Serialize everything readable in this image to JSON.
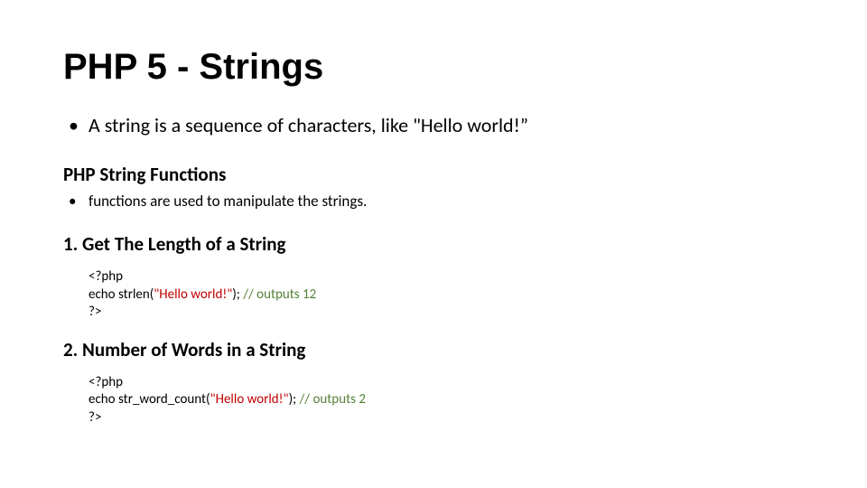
{
  "title": "PHP 5 -  Strings",
  "intro_bullet": "A string is a sequence of characters, like \"Hello world!”",
  "functions_heading": "PHP String Functions",
  "functions_bullet": "functions are used to manipulate the strings.",
  "ex1": {
    "heading": "1. Get The Length of a String",
    "open": "<?php",
    "echo": "echo strlen(",
    "string": "\"Hello world!\"",
    "after": "); ",
    "comment": "// outputs 12",
    "close": "?>"
  },
  "ex2": {
    "heading": "2. Number of Words in a String",
    "open": "<?php",
    "echo": "echo str_word_count(",
    "string": "\"Hello world!\"",
    "after": "); ",
    "comment": "// outputs 2",
    "close": "?>"
  }
}
